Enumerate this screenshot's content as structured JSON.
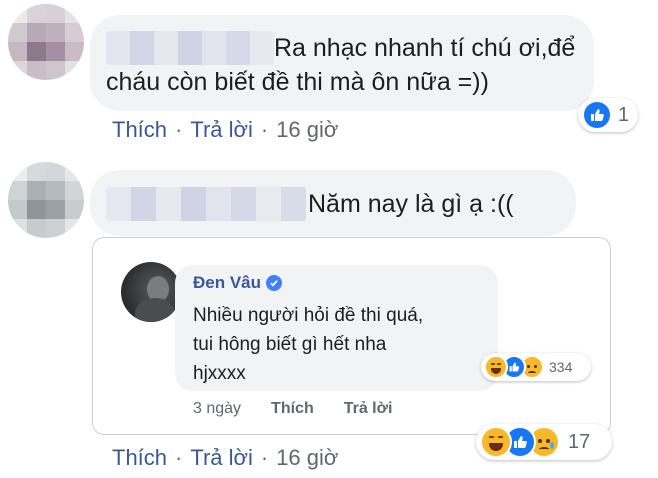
{
  "comments": [
    {
      "text_line1": "Ra nhạc nhanh tí chú ơi,để",
      "text_line2": "cháu còn biết đề thi mà ôn nữa =))",
      "like_label": "Thích",
      "reply_label": "Trả lời",
      "time": "16 giờ",
      "reaction_count": "1",
      "reaction_icons": [
        "like-icon"
      ]
    },
    {
      "text_line1": "Năm nay là gì ạ :((",
      "like_label": "Thích",
      "reply_label": "Trả lời",
      "time": "16 giờ",
      "reaction_count": "17",
      "reaction_icons": [
        "haha-icon",
        "like-icon",
        "sad-icon"
      ]
    }
  ],
  "reply": {
    "author": "Đen Vâu",
    "verified": true,
    "text_line1": "Nhiều người hỏi đề thi quá,",
    "text_line2": "tui hông biết gì hết nha",
    "text_line3": "hjxxxx",
    "time": "3 ngày",
    "like_label": "Thích",
    "reply_label": "Trả lời",
    "reaction_count": "334",
    "reaction_icons": [
      "haha-icon",
      "like-icon",
      "sad-icon"
    ]
  },
  "colors": {
    "link": "#385898",
    "bubble": "#f2f3f5",
    "like_blue": "#1877f2",
    "haha_yellow": "#f7b928",
    "muted": "#606770"
  }
}
